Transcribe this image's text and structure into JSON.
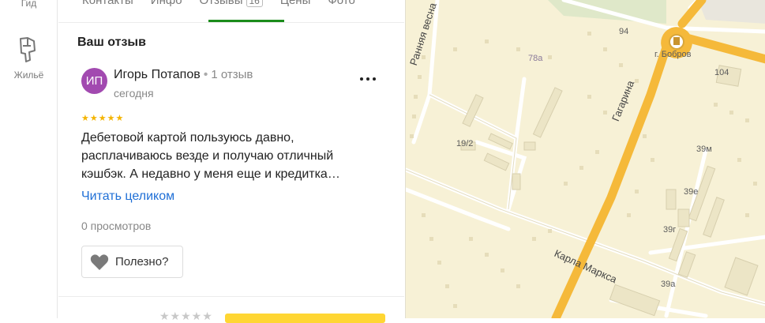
{
  "rail": {
    "guide_label": "Гид",
    "housing_label": "Жильё"
  },
  "tabs": [
    {
      "label": "Контакты"
    },
    {
      "label": "Инфо"
    },
    {
      "label": "Отзывы",
      "count": "16",
      "active": true
    },
    {
      "label": "Цены"
    },
    {
      "label": "Фото"
    }
  ],
  "review": {
    "section_title": "Ваш отзыв",
    "avatar_initials": "ИП",
    "author": "Игорь Потапов",
    "author_reviews": "1 отзыв",
    "date": "сегодня",
    "rating": 5,
    "text_lines": [
      "Дебетовой картой пользуюсь давно,",
      "расплачиваюсь везде и получаю отличный",
      "кэшбэк. А недавно у меня еще и кредитка…"
    ],
    "read_more": "Читать целиком",
    "views": "0 просмотров",
    "useful_label": "Полезно?"
  },
  "map": {
    "labels": [
      "94",
      "г. Бобров",
      "104",
      "78а",
      "19/2",
      "39м",
      "39е",
      "39г",
      "39а"
    ],
    "streets": [
      "Ранняя весна",
      "Гагарина",
      "Карла Маркса"
    ]
  },
  "colors": {
    "accent_green": "#1b8c1b",
    "link_blue": "#1f6fd6",
    "avatar_purple": "#a24ab0",
    "star_yellow": "#f4b400",
    "map_bg": "#f7f1d6",
    "road_orange": "#f5b93a"
  }
}
